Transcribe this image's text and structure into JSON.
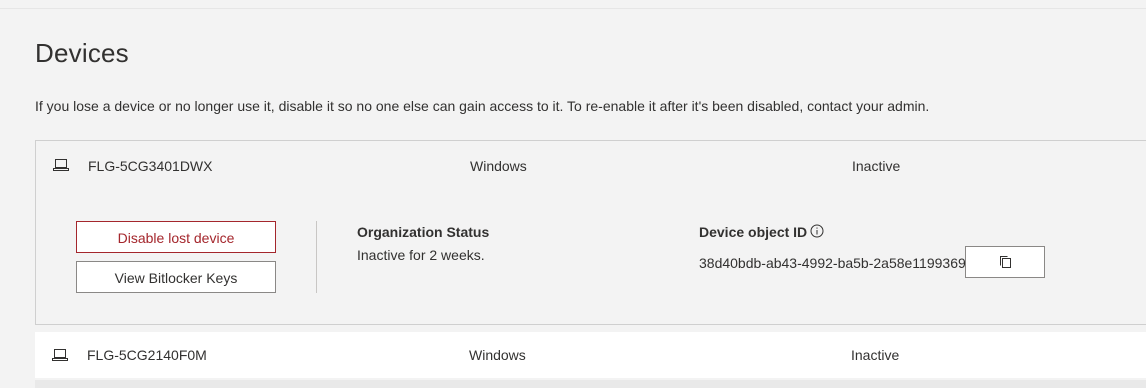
{
  "page": {
    "title": "Devices",
    "intro": "If you lose a device or no longer use it, disable it so no one else can gain access to it. To re-enable it after it's been disabled, contact your admin."
  },
  "devices": [
    {
      "name": "FLG-5CG3401DWX",
      "os": "Windows",
      "status": "Inactive",
      "icon": "laptop-icon",
      "expanded": true,
      "disable_label": "Disable lost device",
      "bitlocker_label": "View Bitlocker Keys",
      "org_status_label": "Organization Status",
      "org_status_value": "Inactive for 2 weeks.",
      "object_id_label": "Device object ID",
      "object_id_value": "38d40bdb-ab43-4992-ba5b-2a58e1199369",
      "copy_icon": "copy-icon",
      "info_icon": "info-icon"
    },
    {
      "name": "FLG-5CG2140F0M",
      "os": "Windows",
      "status": "Inactive",
      "icon": "laptop-icon",
      "expanded": false
    }
  ],
  "colors": {
    "background": "#f3f3f3",
    "danger": "#a4262c",
    "border": "#8a8886",
    "text": "#323130"
  }
}
